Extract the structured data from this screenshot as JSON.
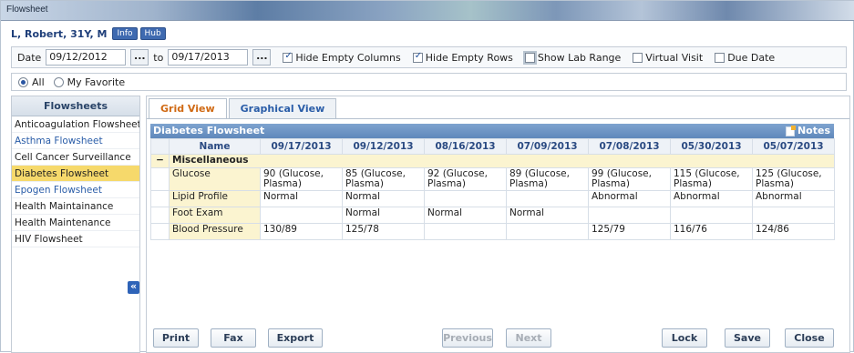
{
  "window": {
    "title": "Flowsheet"
  },
  "patient": {
    "name": "L, Robert, 31Y, M",
    "info_label": "Info",
    "hub_label": "Hub"
  },
  "filters": {
    "date_label": "Date",
    "from_date": "09/12/2012",
    "to_label": "to",
    "to_date": "09/17/2013",
    "dots": "...",
    "options": [
      {
        "label": "Hide Empty Columns",
        "checked": true
      },
      {
        "label": "Hide Empty Rows",
        "checked": true
      },
      {
        "label": "Show Lab Range",
        "checked": false
      },
      {
        "label": "Virtual Visit",
        "checked": false
      },
      {
        "label": "Due Date",
        "checked": false
      }
    ]
  },
  "scope": {
    "all_label": "All",
    "favorite_label": "My Favorite",
    "selected": "All"
  },
  "sidebar": {
    "header": "Flowsheets",
    "items": [
      {
        "label": "Anticoagulation Flowsheet",
        "style": "normal"
      },
      {
        "label": "Asthma Flowsheet",
        "style": "link"
      },
      {
        "label": "Cell Cancer Surveillance",
        "style": "normal"
      },
      {
        "label": "Diabetes Flowsheet",
        "style": "active"
      },
      {
        "label": "Epogen Flowsheet",
        "style": "link"
      },
      {
        "label": "Health Maintainance",
        "style": "normal"
      },
      {
        "label": "Health Maintenance",
        "style": "normal"
      },
      {
        "label": "HIV Flowsheet",
        "style": "normal"
      }
    ],
    "collapse_glyph": "«"
  },
  "tabs": [
    {
      "label": "Grid View",
      "active": true
    },
    {
      "label": "Graphical View",
      "active": false
    }
  ],
  "grid": {
    "title": "Diabetes Flowsheet",
    "notes_label": "Notes",
    "name_header": "Name",
    "dates": [
      "09/17/2013",
      "09/12/2013",
      "08/16/2013",
      "07/09/2013",
      "07/08/2013",
      "05/30/2013",
      "05/07/2013"
    ],
    "group": {
      "toggle": "−",
      "label": "Miscellaneous"
    },
    "rows": [
      {
        "name": "Glucose",
        "values": [
          "90 (Glucose, Plasma)",
          "85 (Glucose, Plasma)",
          "92 (Glucose, Plasma)",
          "89 (Glucose, Plasma)",
          "99 (Glucose, Plasma)",
          "115 (Glucose, Plasma)",
          "125 (Glucose, Plasma)"
        ]
      },
      {
        "name": "Lipid Profile",
        "values": [
          "Normal",
          "Normal",
          "",
          "",
          "Abnormal",
          "Abnormal",
          "Abnormal"
        ]
      },
      {
        "name": "Foot Exam",
        "values": [
          "",
          "Normal",
          "Normal",
          "Normal",
          "",
          "",
          ""
        ]
      },
      {
        "name": "Blood Pressure",
        "values": [
          "130/89",
          "125/78",
          "",
          "",
          "125/79",
          "116/76",
          "124/86"
        ]
      }
    ]
  },
  "footer": {
    "print": "Print",
    "fax": "Fax",
    "export": "Export",
    "previous": "Previous",
    "next": "Next",
    "lock": "Lock",
    "save": "Save",
    "close": "Close"
  },
  "colors": {
    "accent": "#2e63b8",
    "active_tab": "#d06a14",
    "selected_item": "#f6d96b",
    "group_row": "#fbf4d0"
  }
}
